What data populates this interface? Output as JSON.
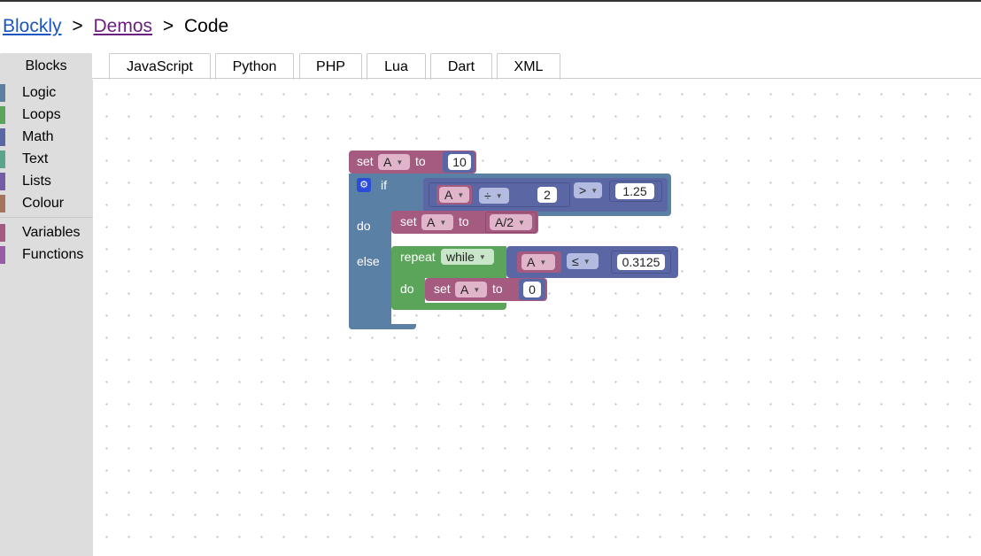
{
  "breadcrumb": {
    "root": "Blockly",
    "sep1": ">",
    "demos": "Demos",
    "sep2": ">",
    "current": "Code"
  },
  "tabs": [
    {
      "label": "Blocks"
    },
    {
      "label": "JavaScript"
    },
    {
      "label": "Python"
    },
    {
      "label": "PHP"
    },
    {
      "label": "Lua"
    },
    {
      "label": "Dart"
    },
    {
      "label": "XML"
    }
  ],
  "toolbox": {
    "categories": [
      {
        "label": "Logic",
        "color": "#5b80a5"
      },
      {
        "label": "Loops",
        "color": "#5ba55b"
      },
      {
        "label": "Math",
        "color": "#5b67a5"
      },
      {
        "label": "Text",
        "color": "#5ba58c"
      },
      {
        "label": "Lists",
        "color": "#745ba5"
      },
      {
        "label": "Colour",
        "color": "#a5745b"
      },
      {
        "label": "Variables",
        "color": "#a55b80"
      },
      {
        "label": "Functions",
        "color": "#995ba5"
      }
    ]
  },
  "blocks": {
    "set1": {
      "set": "set",
      "var": "A",
      "to": "to",
      "value": "10"
    },
    "if": {
      "if": "if",
      "do": "do",
      "else": "else"
    },
    "cond": {
      "var": "A",
      "op": "÷",
      "divisor": "2",
      "cmp": ">",
      "rhs": "1.25"
    },
    "set2": {
      "set": "set",
      "var": "A",
      "to": "to",
      "value": "A/2"
    },
    "repeat": {
      "repeat": "repeat",
      "mode": "while",
      "do": "do"
    },
    "cond2": {
      "var": "A",
      "cmp": "≤",
      "rhs": "0.3125"
    },
    "set3": {
      "set": "set",
      "var": "A",
      "to": "to",
      "value": "0"
    }
  },
  "colors": {
    "variables": "#a55b80",
    "logic": "#5b80a5",
    "math": "#5b67a5",
    "loops": "#5ba55b"
  }
}
